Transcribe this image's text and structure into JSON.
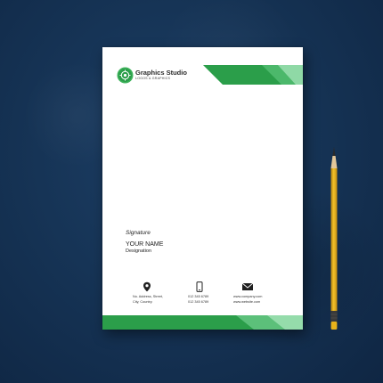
{
  "letterhead": {
    "company_name": "Graphics Studio",
    "company_tagline": "LOGOS & GRAPHICS",
    "signature_label": "Signature",
    "your_name": "YOUR NAME",
    "designation": "Designation",
    "contacts": {
      "address_line1": "No. Address, Street,",
      "address_line2": "City, Country.",
      "phone_line1": "012 345 6789",
      "phone_line2": "012 345 6789",
      "email": "www.company.com",
      "website": "www.website.com"
    },
    "colors": {
      "brand_green": "#2b9e4a",
      "light_green": "#7fd39a",
      "background_blue": "#163456",
      "pencil_yellow": "#e8b21a"
    }
  },
  "icons": [
    "logo-badge-icon",
    "location-pin-icon",
    "mobile-phone-icon",
    "envelope-icon"
  ]
}
